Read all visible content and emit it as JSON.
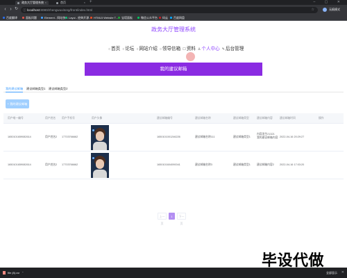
{
  "browser": {
    "tabs": [
      {
        "title": "政务大厅管理系统",
        "active": true
      },
      {
        "title": "首页",
        "active": false
      }
    ],
    "new_tab": "+",
    "window_controls": "– ▢ ✕",
    "url_host": "localhost",
    "url_path": ":8080/zhengwuxitong/front/index.html",
    "profile_name": "无痕模式",
    "bookmarks": [
      {
        "label": "百度翻译",
        "color": "#2b6de5"
      },
      {
        "label": "面板问题",
        "color": "#e0534a"
      },
      {
        "label": "Element - 网站快...",
        "color": "#409eff"
      },
      {
        "label": "Layui - 经典开源...",
        "color": "#16b777"
      },
      {
        "label": "HTML5 Website T...",
        "color": "#e44d26"
      },
      {
        "label": "宝塔面板",
        "color": "#20a53a"
      },
      {
        "label": "微信公众平台",
        "color": "#07c160"
      },
      {
        "label": "码云",
        "color": "#c71d23"
      },
      {
        "label": "百度网盘",
        "color": "#06a7ff"
      }
    ]
  },
  "page": {
    "site_title": "政务大厅管理系统",
    "nav": [
      {
        "icon": "○",
        "label": "首页",
        "active": false
      },
      {
        "icon": "○",
        "label": "论坛",
        "active": false
      },
      {
        "icon": "○",
        "label": "网站介绍",
        "active": false
      },
      {
        "icon": "○",
        "label": "领导信箱",
        "active": false
      },
      {
        "icon": "☐",
        "label": "资料",
        "active": false
      },
      {
        "icon": "♙",
        "label": "个人中心",
        "active": true
      },
      {
        "icon": "✎",
        "label": "后台管理",
        "active": false
      }
    ],
    "banner_text": "我的建议邮箱",
    "tabs": [
      {
        "label": "我的建议邮箱",
        "active": true
      },
      {
        "label": "建议邮箱类型1",
        "active": false
      },
      {
        "label": "建议邮箱类型2",
        "active": false
      }
    ],
    "add_button": "+ 我的建议邮箱",
    "table": {
      "headers": [
        "用户唯一编号",
        "用户姓名",
        "用户手机号",
        "用户头像",
        "建议邮箱编号",
        "建议邮箱名称",
        "建议邮箱类型",
        "建议邮箱内容",
        "建议邮箱时间",
        "操作"
      ],
      "rows": [
        {
          "uid": "1650101659082614",
          "name": "用户姓名2",
          "phone": "17703766662",
          "mail_no": "1650101001246226",
          "mail_name": "建议邮箱名称111",
          "mail_type": "建议邮箱类型1",
          "content": "内容发生21321\n我的建议邮箱内容",
          "time": "2022-04-16 20:29:27"
        },
        {
          "uid": "1650101659082614",
          "name": "用户姓名2",
          "phone": "17703766662",
          "mail_no": "1650101604090041",
          "mail_name": "建议邮箱名称3",
          "mail_type": "建议邮箱类型1",
          "content": "建议邮箱内容2",
          "time": "2022-04-16 17:03:20"
        }
      ]
    },
    "pager": {
      "prev": "上一页",
      "current": "1",
      "next": "下一页"
    }
  },
  "watermark": "毕设代做",
  "downloads": {
    "file": "file (8).rar",
    "show_all": "全部显示",
    "close": "✕"
  }
}
